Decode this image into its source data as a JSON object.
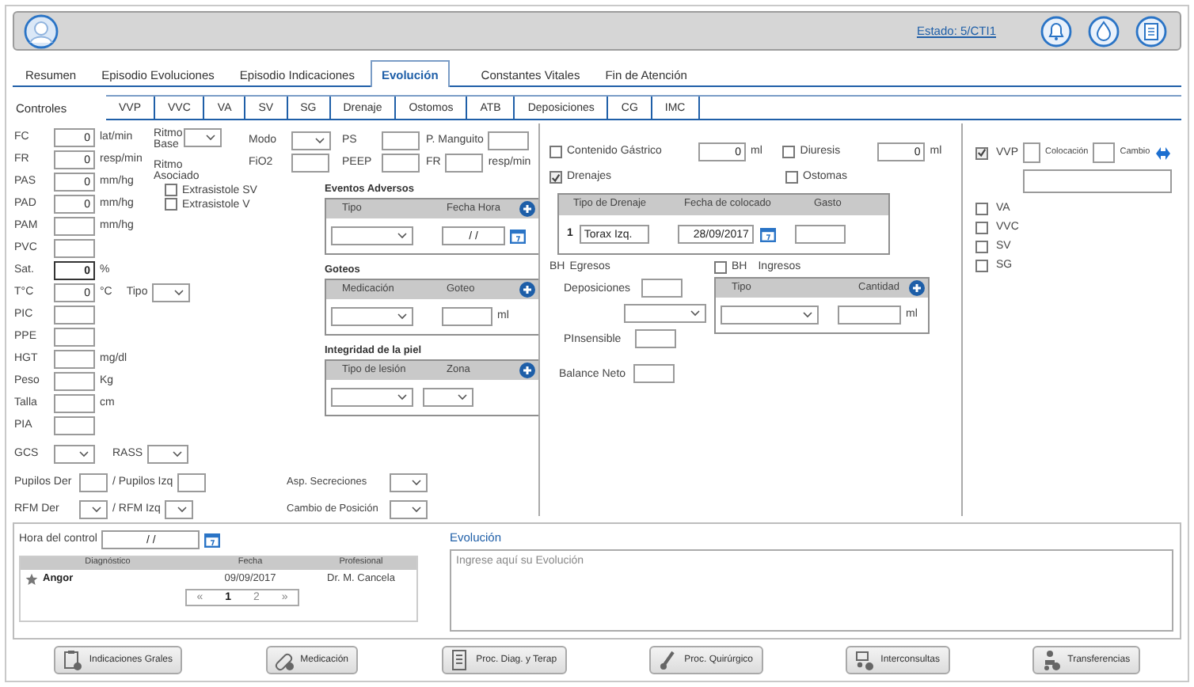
{
  "header": {
    "status_link": "Estado: 5/CTI1"
  },
  "tabs": [
    {
      "label": "Resumen",
      "selected": false
    },
    {
      "label": "Episodio Evoluciones",
      "selected": false
    },
    {
      "label": "Episodio Indicaciones",
      "selected": false
    },
    {
      "label": "Evolución",
      "selected": true
    },
    {
      "label": "Constantes Vitales",
      "selected": false
    },
    {
      "label": "Fin de Atención",
      "selected": false
    }
  ],
  "subtabs": {
    "label": "Controles",
    "items": [
      "VVP",
      "VVC",
      "VA",
      "SV",
      "SG",
      "Drenaje",
      "Ostomos",
      "ATB",
      "Deposiciones",
      "CG",
      "IMC"
    ]
  },
  "vitals": [
    {
      "label": "FC",
      "value": "0",
      "unit": "lat/min",
      "focused": false
    },
    {
      "label": "FR",
      "value": "0",
      "unit": "resp/min",
      "focused": false
    },
    {
      "label": "PAS",
      "value": "0",
      "unit": "mm/hg",
      "focused": false
    },
    {
      "label": "PAD",
      "value": "0",
      "unit": "mm/hg",
      "focused": false
    },
    {
      "label": "PAM",
      "unit": "mm/hg",
      "focused": false
    },
    {
      "label": "PVC",
      "focused": false
    },
    {
      "label": "Sat.",
      "value": "0",
      "unit": "%",
      "focused": true
    },
    {
      "label": "T°C",
      "value": "0",
      "unit": "°C",
      "select_label": "Tipo",
      "focused": false
    },
    {
      "label": "PIC",
      "focused": false
    },
    {
      "label": "PPE",
      "focused": false
    },
    {
      "label": "HGT",
      "unit": "mg/dl",
      "focused": false
    },
    {
      "label": "Peso",
      "unit": "Kg",
      "focused": false
    },
    {
      "label": "Talla",
      "unit": "cm",
      "focused": false
    },
    {
      "label": "PIA",
      "focused": false
    }
  ],
  "scores": [
    "GCS",
    "RASS"
  ],
  "paired_rows": [
    {
      "kind": "input",
      "labels": [
        "Pupilos Der",
        "/ Pupilos Izq"
      ]
    },
    {
      "kind": "select",
      "labels": [
        "RFM Der",
        "/ RFM Izq"
      ]
    }
  ],
  "care": [
    "Asp. Secreciones",
    "Cambio de Posición"
  ],
  "rhythm": {
    "base_label": "Ritmo Base",
    "assoc_label": "Ritmo Asociado",
    "options": [
      {
        "label": "Extrasistole SV",
        "checked": false
      },
      {
        "label": "Extrasistole V",
        "checked": false
      }
    ]
  },
  "ventilation": [
    [
      {
        "label": "Modo",
        "kind": "select"
      },
      {
        "label": "PS",
        "kind": "input"
      },
      {
        "label": "P. Manguito",
        "kind": "input"
      }
    ],
    [
      {
        "label": "FiO2",
        "kind": "input"
      },
      {
        "label": "PEEP",
        "kind": "input"
      },
      {
        "label": "FR",
        "kind": "input",
        "unit": "resp/min"
      }
    ]
  ],
  "grids": [
    {
      "title": "Eventos Adversos",
      "columns": [
        {
          "label": "Tipo",
          "kind": "select"
        },
        {
          "label": "Fecha Hora",
          "kind": "date",
          "value": "/ /"
        }
      ]
    },
    {
      "title": "Goteos",
      "columns": [
        {
          "label": "Medicación",
          "kind": "select"
        },
        {
          "label": "Goteo",
          "kind": "input",
          "unit": "ml"
        }
      ]
    },
    {
      "title": "Integridad de la piel",
      "columns": [
        {
          "label": "Tipo de lesión",
          "kind": "select"
        },
        {
          "label": "Zona",
          "kind": "small-select"
        }
      ]
    }
  ],
  "outputs": [
    {
      "label": "Contenido Gástrico",
      "checked": false,
      "value": "0",
      "unit": "ml"
    },
    {
      "label": "Diuresis",
      "checked": false,
      "value": "0",
      "unit": "ml"
    }
  ],
  "drainage": {
    "label": "Drenajes",
    "checked": true,
    "columns": [
      "Tipo de Drenaje",
      "Fecha de colocado",
      "Gasto"
    ],
    "rows": [
      {
        "index": "1",
        "type": "Torax Izq.",
        "date": "28/09/2017"
      }
    ]
  },
  "ostomies": {
    "label": "Ostomas",
    "checked": false
  },
  "balance": {
    "bh": "BH",
    "egresos": "Egresos",
    "fields": [
      "Deposiciones",
      "PInsensible",
      "Balance Neto"
    ],
    "intake": {
      "checked": false,
      "bh": "BH",
      "label": "Ingresos",
      "columns": [
        "Tipo",
        "Cantidad"
      ],
      "unit": "ml"
    }
  },
  "lines": [
    {
      "label": "VVP",
      "checked": true,
      "kind": "detailed",
      "placement_label": "Colocación",
      "change_label": "Cambio"
    },
    {
      "label": "VA",
      "checked": false,
      "kind": "simple"
    },
    {
      "label": "VVC",
      "checked": false,
      "kind": "simple"
    },
    {
      "label": "SV",
      "checked": false,
      "kind": "simple"
    },
    {
      "label": "SG",
      "checked": false,
      "kind": "simple"
    }
  ],
  "control": {
    "label": "Hora del control",
    "value": "/ /"
  },
  "diagnoses": {
    "columns": [
      "Diagnóstico",
      "Fecha",
      "Profesional"
    ],
    "rows": [
      {
        "diagnosis": "Angor",
        "date": "09/09/2017",
        "professional": "Dr. M. Cancela"
      }
    ]
  },
  "pagination": {
    "prev": "«",
    "next": "»",
    "pages": [
      {
        "label": "1",
        "selected": true
      },
      {
        "label": "2",
        "selected": false
      }
    ]
  },
  "evolution": {
    "title": "Evolución",
    "placeholder": "Ingrese aquí su Evolución"
  },
  "actions": [
    {
      "label": "Indicaciones Grales",
      "kind": "clipboard"
    },
    {
      "label": "Medicación",
      "kind": "pills"
    },
    {
      "label": "Proc. Diag. y Terap",
      "kind": "list"
    },
    {
      "label": "Proc. Quirúrgico",
      "kind": "scalpel"
    },
    {
      "label": "Interconsultas",
      "kind": "consult"
    },
    {
      "label": "Transferencias",
      "kind": "person"
    }
  ]
}
